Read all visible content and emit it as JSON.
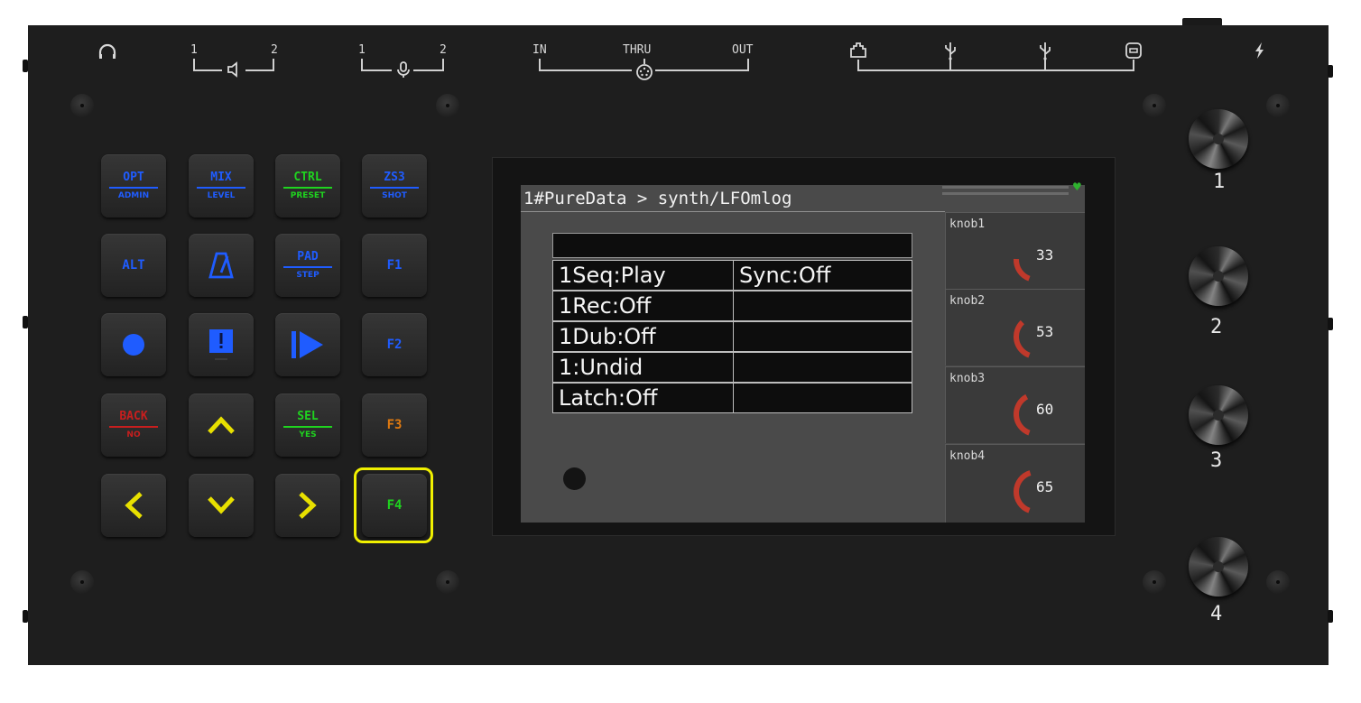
{
  "connectors": {
    "audio_out_1": "1",
    "audio_out_2": "2",
    "audio_in_1": "1",
    "audio_in_2": "2",
    "midi_in": "IN",
    "midi_thru": "THRU",
    "midi_out": "OUT"
  },
  "keys": [
    {
      "top": "OPT",
      "bottom": "ADMIN",
      "color": "#1f5cff"
    },
    {
      "top": "MIX",
      "bottom": "LEVEL",
      "color": "#1f5cff"
    },
    {
      "top": "CTRL",
      "bottom": "PRESET",
      "color": "#1fd41f"
    },
    {
      "top": "ZS3",
      "bottom": "SHOT",
      "color": "#1f5cff"
    },
    {
      "label": "ALT",
      "color": "#1f5cff"
    },
    {
      "label": "F1",
      "color": "#1f5cff"
    },
    {
      "top": "PAD",
      "bottom": "STEP",
      "color": "#1f5cff"
    },
    {
      "label": "F2",
      "color": "#1f5cff"
    },
    {
      "top": "BACK",
      "bottom": "NO",
      "color": "#c81e1e"
    },
    {
      "top": "SEL",
      "bottom": "YES",
      "color": "#1fd41f"
    },
    {
      "label": "F3",
      "color": "#e07a10"
    },
    {
      "label": "F4",
      "color": "#1fd41f"
    }
  ],
  "screen": {
    "title": "1#PureData > synth/LFOmlog",
    "rows": [
      [
        "1Seq:Play",
        "Sync:Off"
      ],
      [
        "1Rec:Off",
        ""
      ],
      [
        "1Dub:Off",
        ""
      ],
      [
        "1:Undid",
        ""
      ],
      [
        "Latch:Off",
        ""
      ]
    ],
    "knobs": [
      {
        "name": "knob1",
        "value": "33",
        "level": 33
      },
      {
        "name": "knob2",
        "value": "53",
        "level": 53
      },
      {
        "name": "knob3",
        "value": "60",
        "level": 60
      },
      {
        "name": "knob4",
        "value": "65",
        "level": 65
      }
    ],
    "accent_color": "#c0392b",
    "status_color": "#2fb22f"
  },
  "encoders": [
    "1",
    "2",
    "3",
    "4"
  ],
  "colors": {
    "blue": "#1f5cff",
    "green": "#1fd41f",
    "red": "#c81e1e",
    "orange": "#e07a10",
    "yellow": "#e8e000",
    "highlight": "#f0f000"
  }
}
